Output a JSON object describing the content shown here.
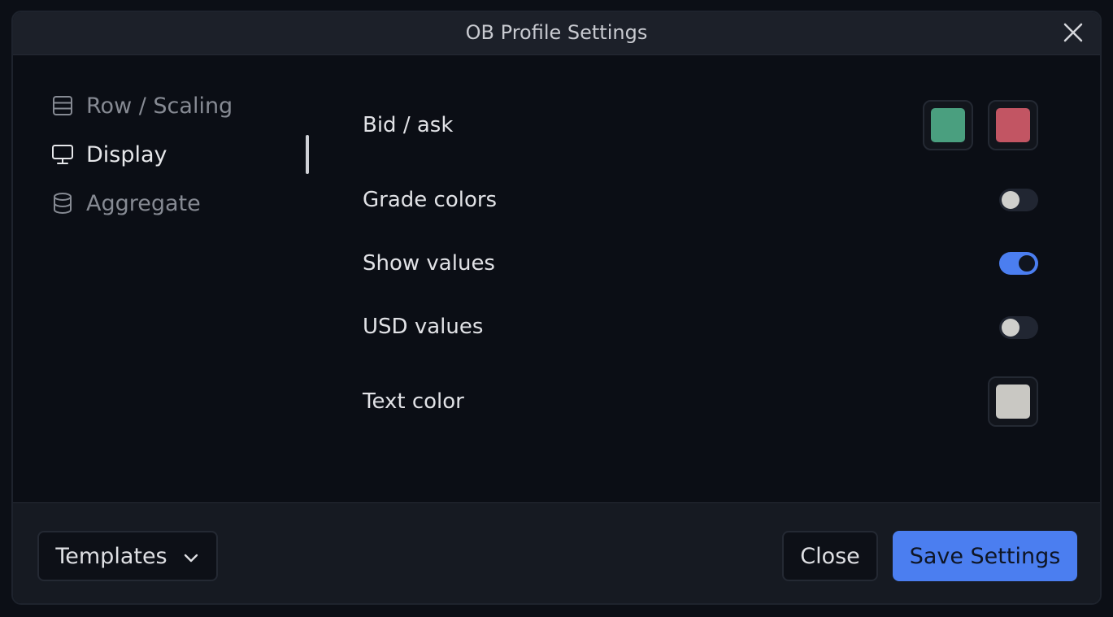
{
  "dialog": {
    "title": "OB Profile Settings"
  },
  "nav": {
    "items": [
      {
        "label": "Row / Scaling",
        "icon": "rows-icon",
        "active": false
      },
      {
        "label": "Display",
        "icon": "monitor-icon",
        "active": true
      },
      {
        "label": "Aggregate",
        "icon": "database-icon",
        "active": false
      }
    ]
  },
  "settings": {
    "bid_ask": {
      "label": "Bid / ask",
      "bid_color": "#4a9f7f",
      "ask_color": "#c25563"
    },
    "grade_colors": {
      "label": "Grade colors",
      "enabled": false
    },
    "show_values": {
      "label": "Show values",
      "enabled": true
    },
    "usd_values": {
      "label": "USD values",
      "enabled": false
    },
    "text_color": {
      "label": "Text color",
      "color": "#c9c8c3"
    }
  },
  "footer": {
    "templates_label": "Templates",
    "close_label": "Close",
    "save_label": "Save Settings"
  },
  "colors": {
    "accent": "#4b7ef0",
    "background": "#0b0e15",
    "header": "#1c2029"
  }
}
